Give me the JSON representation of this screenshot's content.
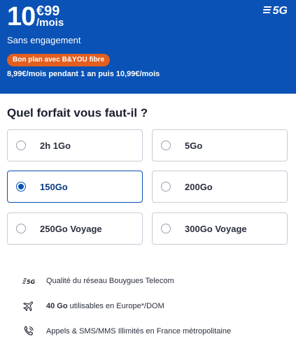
{
  "header": {
    "price_integer": "10",
    "price_decimal": "€99",
    "price_period": "/mois",
    "network_badge": "5G",
    "commitment": "Sans engagement",
    "promo_label": "Bon plan avec B&YOU fibre",
    "promo_detail": "8,99€/mois pendant 1 an puis 10,99€/mois",
    "colors": {
      "brand_blue": "#0a52b5",
      "promo_orange": "#e35f1f"
    }
  },
  "plan_selector": {
    "question": "Quel forfait vous faut-il ?",
    "selected": "150Go",
    "options": [
      {
        "label": "2h 1Go",
        "selected": false
      },
      {
        "label": "5Go",
        "selected": false
      },
      {
        "label": "150Go",
        "selected": true
      },
      {
        "label": "200Go",
        "selected": false
      },
      {
        "label": "250Go Voyage",
        "selected": false
      },
      {
        "label": "300Go Voyage",
        "selected": false
      }
    ]
  },
  "features": [
    {
      "icon": "5g-icon",
      "icon_text": "5G",
      "text_bold": "",
      "text": "Qualité du réseau Bouygues Telecom"
    },
    {
      "icon": "airplane-icon",
      "text_bold": "40 Go",
      "text": " utilisables en Europe*/DOM"
    },
    {
      "icon": "phone-icon",
      "text_bold": "",
      "text": "Appels & SMS/MMS Illimités en France métropolitaine"
    }
  ]
}
